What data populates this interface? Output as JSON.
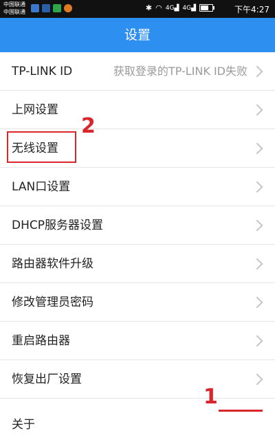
{
  "status_bar": {
    "carriers": [
      "中国联通",
      "中国联通"
    ],
    "network_labels": [
      "4G",
      "4G"
    ],
    "battery_level": 0.7,
    "time": "下午4:27"
  },
  "header": {
    "title": "设置"
  },
  "settings": {
    "items": [
      {
        "label": "TP-LINK ID",
        "value": "获取登录的TP-LINK ID失败"
      },
      {
        "label": "上网设置"
      },
      {
        "label": "无线设置"
      },
      {
        "label": "LAN口设置"
      },
      {
        "label": "DHCP服务器设置"
      },
      {
        "label": "路由器软件升级"
      },
      {
        "label": "修改管理员密码"
      },
      {
        "label": "重启路由器"
      },
      {
        "label": "恢复出厂设置"
      },
      {
        "label": "关于"
      }
    ]
  },
  "annotations": {
    "step1": "1",
    "step2": "2",
    "color": "#d9262c"
  },
  "colors": {
    "accent": "#2d8ff0",
    "status_bar": "#111111"
  }
}
